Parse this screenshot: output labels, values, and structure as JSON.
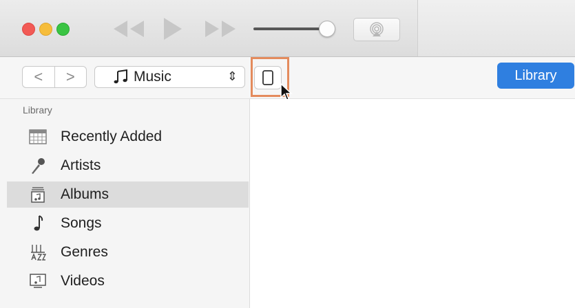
{
  "window": {
    "traffic_lights": [
      "close",
      "minimize",
      "zoom"
    ],
    "controls": {
      "rewind_icon": "rewind-icon",
      "play_icon": "play-icon",
      "fast_forward_icon": "fast-forward-icon",
      "airplay_icon": "airplay-icon"
    },
    "volume_level": 0.95
  },
  "toolbar": {
    "back_glyph": "<",
    "forward_glyph": ">",
    "media_kind": "Music",
    "media_icon": "music-note-icon",
    "device_icon": "device-icon",
    "library_button": "Library",
    "accent_color": "#2f7fe0",
    "highlight_color": "#e48b5d"
  },
  "sidebar": {
    "header": "Library",
    "items": [
      {
        "label": "Recently Added",
        "icon": "calendar-grid-icon",
        "selected": false
      },
      {
        "label": "Artists",
        "icon": "microphone-icon",
        "selected": false
      },
      {
        "label": "Albums",
        "icon": "album-icon",
        "selected": true
      },
      {
        "label": "Songs",
        "icon": "music-note-icon",
        "selected": false
      },
      {
        "label": "Genres",
        "icon": "genres-icon",
        "selected": false
      },
      {
        "label": "Videos",
        "icon": "video-icon",
        "selected": false
      }
    ]
  }
}
